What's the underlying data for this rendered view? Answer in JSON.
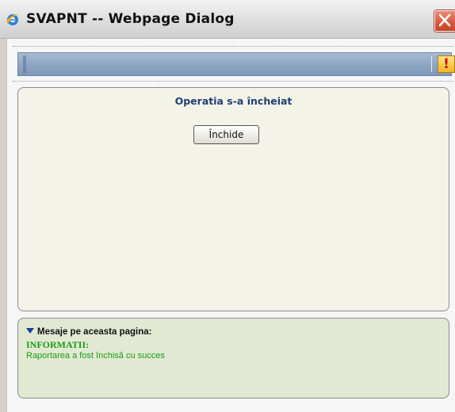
{
  "window": {
    "title": "SVAPNT -- Webpage Dialog",
    "app_icon": "internet-explorer-icon",
    "close_icon": "close-x-icon"
  },
  "toolbar": {
    "warning_icon": "exclamation-warning-icon",
    "warning_glyph": "!"
  },
  "main": {
    "title": "Operatia s-a încheiat",
    "close_button_label": "Închide"
  },
  "messages": {
    "header": "Mesaje pe aceasta pagina:",
    "category": "INFORMATII:",
    "text": "Raportarea a fost închisă cu succes",
    "colors": {
      "category": "#1b9a14",
      "text": "#1b9a14"
    }
  },
  "colors": {
    "panel_background": "#f4f3e9",
    "message_background": "#e2e9d3",
    "toolbar": "#8fa7c4",
    "title_accent": "#1f3f70"
  }
}
